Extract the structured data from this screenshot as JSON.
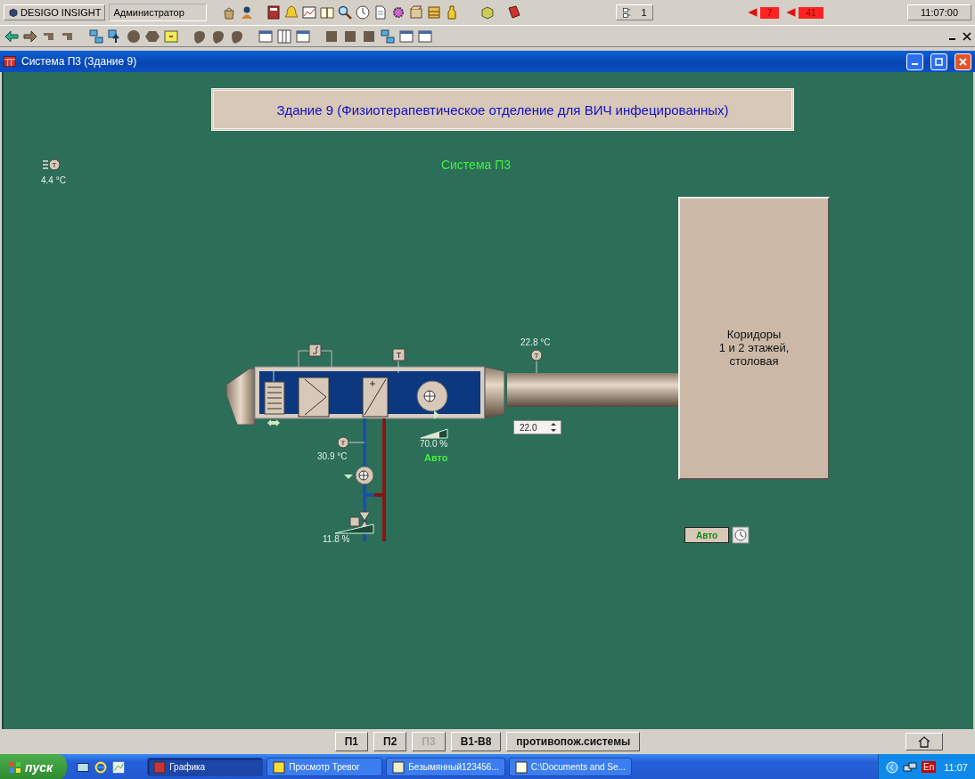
{
  "toolbar": {
    "app_name": "DESIGO INSIGHT",
    "user": "Администратор",
    "counter": "1",
    "alarms": [
      {
        "count": "7"
      },
      {
        "count": "41"
      }
    ],
    "clock": "11:07:00"
  },
  "window": {
    "title": "Система П3 (Здание 9)"
  },
  "plant": {
    "header": "Здание 9 (Физиотерапевтическое отделение для ВИЧ инфецированных)",
    "system_label": "Система П3",
    "outdoor_temp": "4.4 °C",
    "supply_temp": "22.8 °C",
    "return_temp": "30.9 °C",
    "fan": {
      "level": 0.7,
      "reading": "70.0 %",
      "mode": "Авто"
    },
    "valve": {
      "level": 0.118,
      "reading": "11.8 %"
    },
    "sensor_marks": [
      "T",
      "T",
      "T",
      "T"
    ],
    "setpoint": "22.0",
    "zone": "Коридоры\n1 и 2 этажей,\nстоловая",
    "mode_button": "Авто"
  },
  "nav": [
    {
      "label": "П1",
      "disabled": false
    },
    {
      "label": "П2",
      "disabled": false
    },
    {
      "label": "П3",
      "disabled": true
    },
    {
      "label": "В1-В8",
      "disabled": false
    },
    {
      "label": "противопож.системы",
      "disabled": false
    }
  ],
  "taskbar": {
    "start": "пуск",
    "tasks": [
      {
        "label": "Графика",
        "selected": true
      },
      {
        "label": "Просмотр Тревог",
        "selected": false
      },
      {
        "label": "Безымянный123456...",
        "selected": false
      },
      {
        "label": "C:\\Documents and Se...",
        "selected": false
      }
    ],
    "language": "En",
    "clock": "11:07"
  }
}
